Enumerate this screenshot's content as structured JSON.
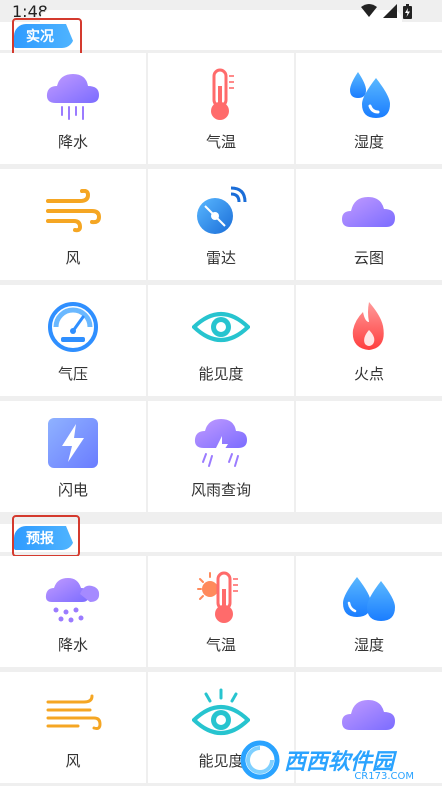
{
  "status": {
    "time": "1:48"
  },
  "sections": [
    {
      "title": "实况",
      "items": [
        {
          "label": "降水",
          "icon": "rain-cloud-icon"
        },
        {
          "label": "气温",
          "icon": "thermometer-icon"
        },
        {
          "label": "湿度",
          "icon": "water-drops-icon"
        },
        {
          "label": "风",
          "icon": "wind-icon"
        },
        {
          "label": "雷达",
          "icon": "radar-dish-icon"
        },
        {
          "label": "云图",
          "icon": "cloud-icon"
        },
        {
          "label": "气压",
          "icon": "gauge-icon"
        },
        {
          "label": "能见度",
          "icon": "eye-icon"
        },
        {
          "label": "火点",
          "icon": "flame-icon"
        },
        {
          "label": "闪电",
          "icon": "lightning-icon"
        },
        {
          "label": "风雨查询",
          "icon": "storm-cloud-icon"
        }
      ]
    },
    {
      "title": "预报",
      "items": [
        {
          "label": "降水",
          "icon": "rain-cloud-icon"
        },
        {
          "label": "气温",
          "icon": "sun-thermometer-icon"
        },
        {
          "label": "湿度",
          "icon": "water-drops-icon"
        },
        {
          "label": "风",
          "icon": "wind-icon"
        },
        {
          "label": "能见度",
          "icon": "eye-icon"
        },
        {
          "label": "",
          "icon": "cloud-icon"
        }
      ]
    }
  ],
  "watermark": {
    "text": "西西软件园",
    "sub": "CR173.COM"
  },
  "colors": {
    "accent": "#2f9bff",
    "highlight": "#d43a2e",
    "purple": "#9b7bff",
    "orange": "#f5a623",
    "red": "#ff5c5c"
  }
}
